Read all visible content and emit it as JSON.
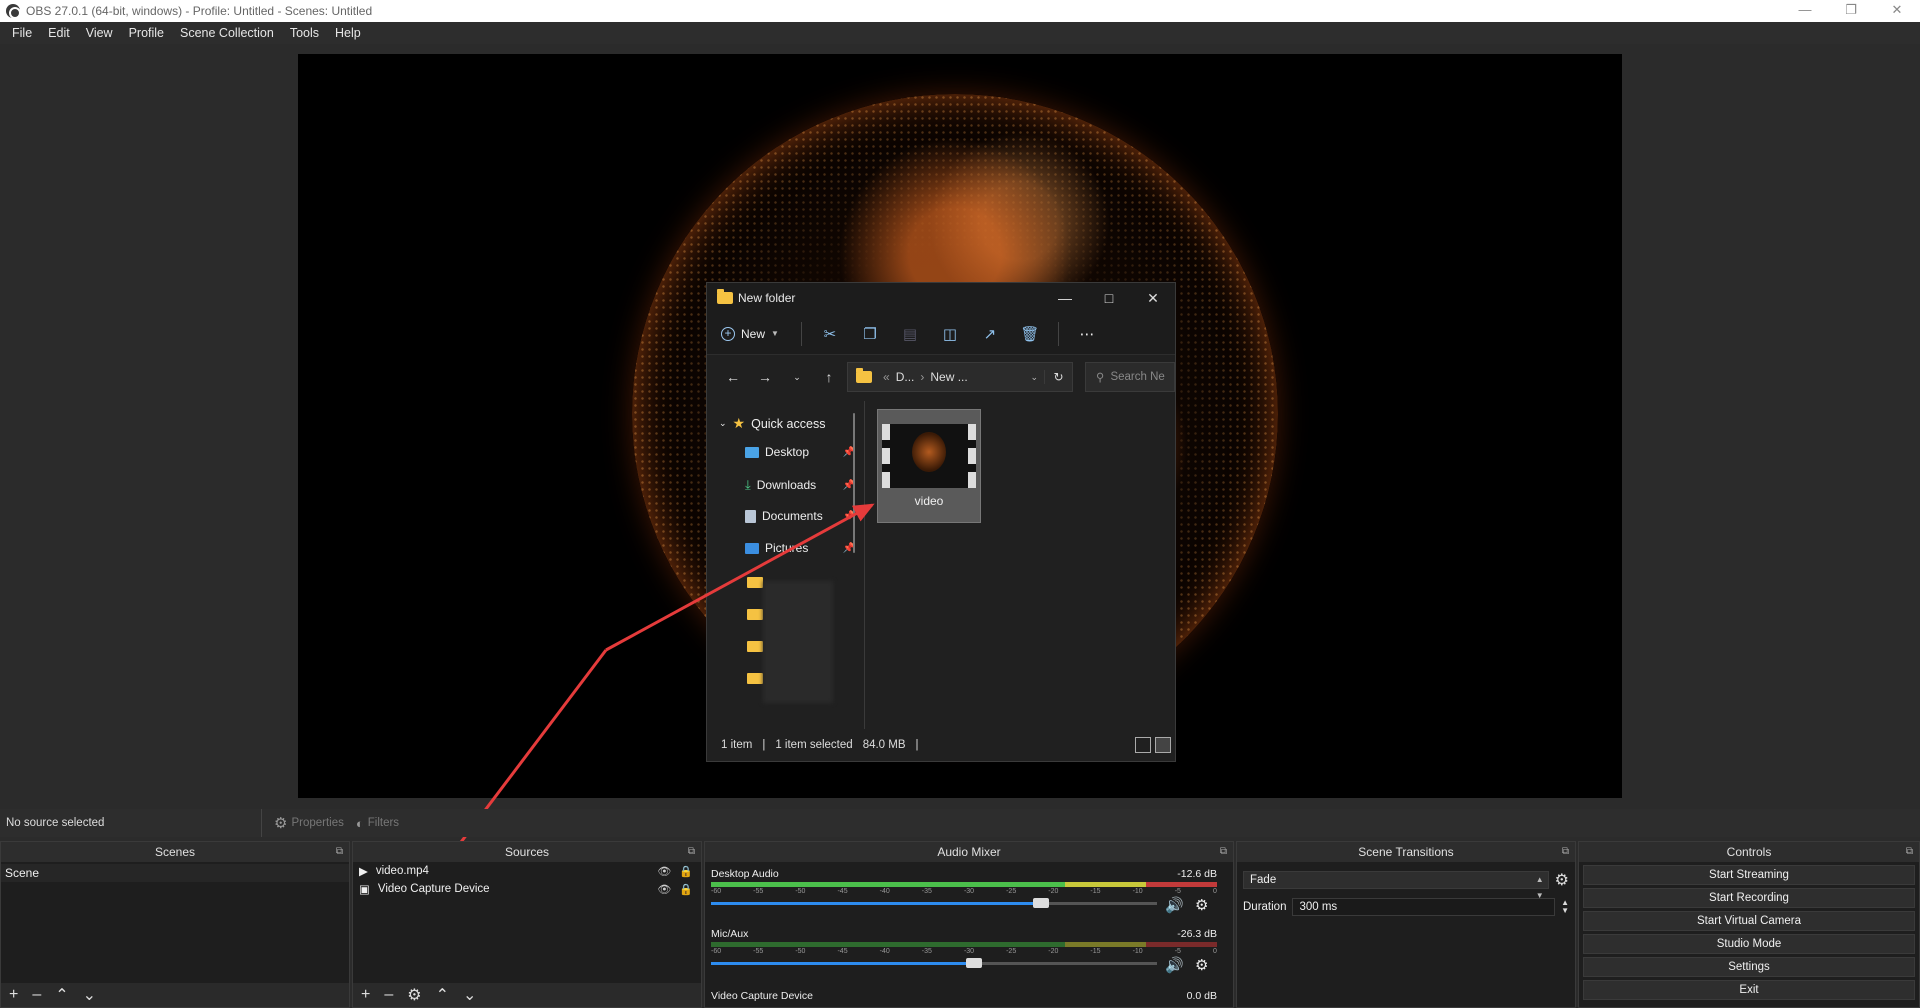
{
  "window": {
    "title": "OBS 27.0.1 (64-bit, windows) - Profile: Untitled - Scenes: Untitled"
  },
  "menu": [
    "File",
    "Edit",
    "View",
    "Profile",
    "Scene Collection",
    "Tools",
    "Help"
  ],
  "explorer": {
    "title": "New folder",
    "new_label": "New",
    "address_root": "D...",
    "address_current": "New ...",
    "search_placeholder": "Search Ne",
    "quick_access": "Quick access",
    "nav_items": [
      "Desktop",
      "Downloads",
      "Documents",
      "Pictures"
    ],
    "file_name": "video",
    "status_count": "1 item",
    "status_selected": "1 item selected",
    "status_size": "84.0 MB"
  },
  "status": {
    "no_source": "No source selected",
    "properties": "Properties",
    "filters": "Filters"
  },
  "scenes": {
    "title": "Scenes",
    "items": [
      "Scene"
    ]
  },
  "sources": {
    "title": "Sources",
    "items": [
      "video.mp4",
      "Video Capture Device"
    ]
  },
  "mixer": {
    "title": "Audio Mixer",
    "ticks": [
      "-60",
      "-55",
      "-50",
      "-45",
      "-40",
      "-35",
      "-30",
      "-25",
      "-20",
      "-15",
      "-10",
      "-5",
      "0"
    ],
    "channels": [
      {
        "name": "Desktop Audio",
        "db": "-12.6 dB",
        "volume": 0.74
      },
      {
        "name": "Mic/Aux",
        "db": "-26.3 dB",
        "volume": 0.59
      },
      {
        "name": "Video Capture Device",
        "db": "0.0 dB"
      }
    ]
  },
  "transitions": {
    "title": "Scene Transitions",
    "selected": "Fade",
    "duration_label": "Duration",
    "duration_value": "300 ms"
  },
  "controls": {
    "title": "Controls",
    "buttons": [
      "Start Streaming",
      "Start Recording",
      "Start Virtual Camera",
      "Studio Mode",
      "Settings",
      "Exit"
    ]
  }
}
